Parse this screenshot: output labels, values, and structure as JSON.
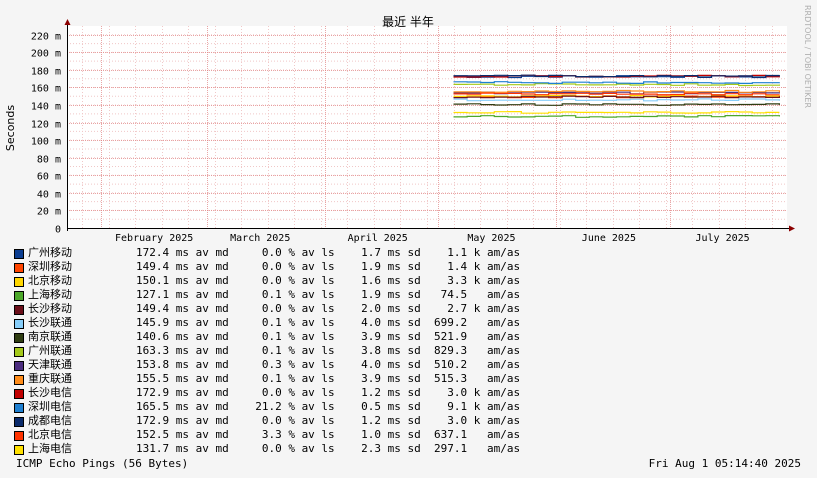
{
  "chart_data": {
    "type": "line",
    "title": "最近 半年",
    "ylabel": "Seconds",
    "watermark": "RRDTOOL / TOBI OETIKER",
    "ylim": [
      0,
      230
    ],
    "y_ticks": [
      {
        "value": 0,
        "label": "0"
      },
      {
        "value": 20,
        "label": "20 m"
      },
      {
        "value": 40,
        "label": "40 m"
      },
      {
        "value": 60,
        "label": "60 m"
      },
      {
        "value": 80,
        "label": "80 m"
      },
      {
        "value": 100,
        "label": "100 m"
      },
      {
        "value": 120,
        "label": "120 m"
      },
      {
        "value": 140,
        "label": "140 m"
      },
      {
        "value": 160,
        "label": "160 m"
      },
      {
        "value": 180,
        "label": "180 m"
      },
      {
        "value": 200,
        "label": "200 m"
      },
      {
        "value": 220,
        "label": "220 m"
      }
    ],
    "x_range": [
      "2025-01-23",
      "2025-08-01"
    ],
    "x_ticks": [
      {
        "date": "2025-02-01",
        "label": "February 2025"
      },
      {
        "date": "2025-03-01",
        "label": "March 2025"
      },
      {
        "date": "2025-04-01",
        "label": "April 2025"
      },
      {
        "date": "2025-05-01",
        "label": "May 2025"
      },
      {
        "date": "2025-06-01",
        "label": "June 2025"
      },
      {
        "date": "2025-07-01",
        "label": "July 2025"
      }
    ],
    "data_start": "2025-05-05",
    "grid": true,
    "series": [
      {
        "name": "广州移动",
        "color": "#0b3d91",
        "avg": 172.4,
        "stats": "172.4 ms av md     0.0 % av ls    1.7 ms sd    1.1 k am/as"
      },
      {
        "name": "深圳移动",
        "color": "#ff4500",
        "avg": 149.4,
        "stats": "149.4 ms av md     0.0 % av ls    1.9 ms sd    1.4 k am/as"
      },
      {
        "name": "北京移动",
        "color": "#ffd700",
        "avg": 150.1,
        "stats": "150.1 ms av md     0.0 % av ls    1.6 ms sd    3.3 k am/as"
      },
      {
        "name": "上海移动",
        "color": "#4ca82a",
        "avg": 127.1,
        "stats": "127.1 ms av md     0.1 % av ls    1.9 ms sd   74.5   am/as"
      },
      {
        "name": "长沙移动",
        "color": "#6b0f1a",
        "avg": 149.4,
        "stats": "149.4 ms av md     0.0 % av ls    2.0 ms sd    2.7 k am/as"
      },
      {
        "name": "长沙联通",
        "color": "#87cefa",
        "avg": 145.9,
        "stats": "145.9 ms av md     0.1 % av ls    4.0 ms sd  699.2   am/as"
      },
      {
        "name": "南京联通",
        "color": "#2f3d12",
        "avg": 140.6,
        "stats": "140.6 ms av md     0.1 % av ls    3.9 ms sd  521.9   am/as"
      },
      {
        "name": "广州联通",
        "color": "#a4c91a",
        "avg": 163.3,
        "stats": "163.3 ms av md     0.1 % av ls    3.8 ms sd  829.3   am/as"
      },
      {
        "name": "天津联通",
        "color": "#4b2c7f",
        "avg": 153.8,
        "stats": "153.8 ms av md     0.3 % av ls    4.0 ms sd  510.2   am/as"
      },
      {
        "name": "重庆联通",
        "color": "#ff8c1a",
        "avg": 155.5,
        "stats": "155.5 ms av md     0.1 % av ls    3.9 ms sd  515.3   am/as"
      },
      {
        "name": "长沙电信",
        "color": "#c00000",
        "avg": 172.9,
        "stats": "172.9 ms av md     0.0 % av ls    1.2 ms sd    3.0 k am/as"
      },
      {
        "name": "深圳电信",
        "color": "#1e7fd0",
        "avg": 165.5,
        "stats": "165.5 ms av md    21.2 % av ls    0.5 ms sd    9.1 k am/as"
      },
      {
        "name": "成都电信",
        "color": "#0a2a6b",
        "avg": 172.9,
        "stats": "172.9 ms av md     0.0 % av ls    1.2 ms sd    3.0 k am/as"
      },
      {
        "name": "北京电信",
        "color": "#ff3300",
        "avg": 152.5,
        "stats": "152.5 ms av md     3.3 % av ls    1.0 ms sd  637.1   am/as"
      },
      {
        "name": "上海电信",
        "color": "#ffe000",
        "avg": 131.7,
        "stats": "131.7 ms av md     0.0 % av ls    2.3 ms sd  297.1   am/as"
      }
    ]
  },
  "footer": {
    "left": "ICMP Echo Pings (56 Bytes)",
    "right": "Fri Aug  1 05:14:40 2025"
  }
}
